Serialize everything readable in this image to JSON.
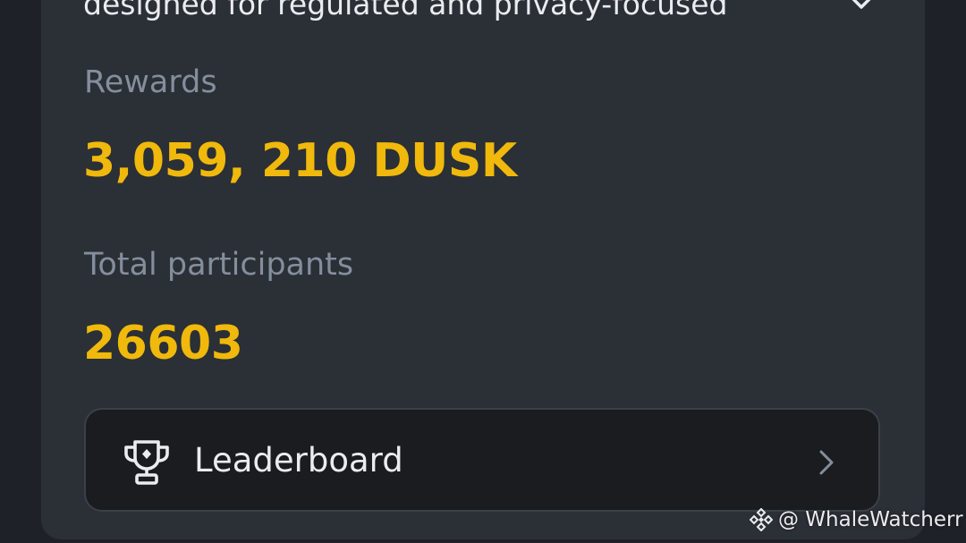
{
  "campaign": {
    "description": "designed for regulated and privacy-focused",
    "rewards_label": "Rewards",
    "rewards_value": "3,059, 210 DUSK",
    "participants_label": "Total participants",
    "participants_value": "26603"
  },
  "leaderboard": {
    "label": "Leaderboard",
    "icon": "trophy-icon"
  },
  "watermark": {
    "text": "@ WhaleWatcherr",
    "logo": "binance-logo-icon"
  },
  "colors": {
    "background": "#1e2228",
    "card": "#2b2f36",
    "accent": "#f0b90b",
    "muted_text": "#848e9c",
    "primary_text": "#eaecef",
    "button_bg": "#1a1c20"
  }
}
